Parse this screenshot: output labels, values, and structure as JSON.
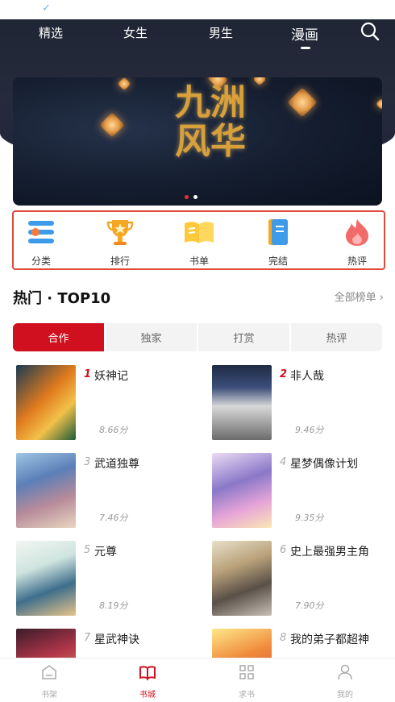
{
  "nav": {
    "tabs": [
      {
        "label": "精选"
      },
      {
        "label": "女生"
      },
      {
        "label": "男生"
      },
      {
        "label": "漫画"
      }
    ],
    "active_tab": "漫画",
    "search_icon": "search-icon"
  },
  "banner": {
    "title_text": "九洲风华",
    "slide_count": 2,
    "active_slide": 1
  },
  "quick_entries": [
    {
      "label": "分类",
      "icon": "category-icon"
    },
    {
      "label": "排行",
      "icon": "trophy-icon"
    },
    {
      "label": "书单",
      "icon": "open-book-icon"
    },
    {
      "label": "完结",
      "icon": "bookmark-book-icon"
    },
    {
      "label": "热评",
      "icon": "flame-icon"
    }
  ],
  "section": {
    "title": "热门 · TOP10",
    "more": "全部榜单 ›"
  },
  "sub_tabs": [
    {
      "label": "合作"
    },
    {
      "label": "独家"
    },
    {
      "label": "打赏"
    },
    {
      "label": "热评"
    }
  ],
  "active_sub_tab": "合作",
  "books": [
    {
      "rank": "1",
      "name": "妖神记",
      "score": "8.66分"
    },
    {
      "rank": "2",
      "name": "非人哉",
      "score": "9.46分"
    },
    {
      "rank": "3",
      "name": "武道独尊",
      "score": "7.46分"
    },
    {
      "rank": "4",
      "name": "星梦偶像计划",
      "score": "9.35分"
    },
    {
      "rank": "5",
      "name": "元尊",
      "score": "8.19分"
    },
    {
      "rank": "6",
      "name": "史上最强男主角",
      "score": "7.90分"
    },
    {
      "rank": "7",
      "name": "星武神诀",
      "score": ""
    },
    {
      "rank": "8",
      "name": "我的弟子都超神",
      "score": ""
    }
  ],
  "tabbar": [
    {
      "label": "书架",
      "icon": "bookshelf-icon"
    },
    {
      "label": "书城",
      "icon": "bookstore-icon"
    },
    {
      "label": "求书",
      "icon": "grid-icon"
    },
    {
      "label": "我的",
      "icon": "profile-icon"
    }
  ],
  "active_tabbar": "书城",
  "colors": {
    "accent": "#d0101e",
    "highlight_border": "#e04a3a",
    "header_bg": "#1e2433"
  }
}
